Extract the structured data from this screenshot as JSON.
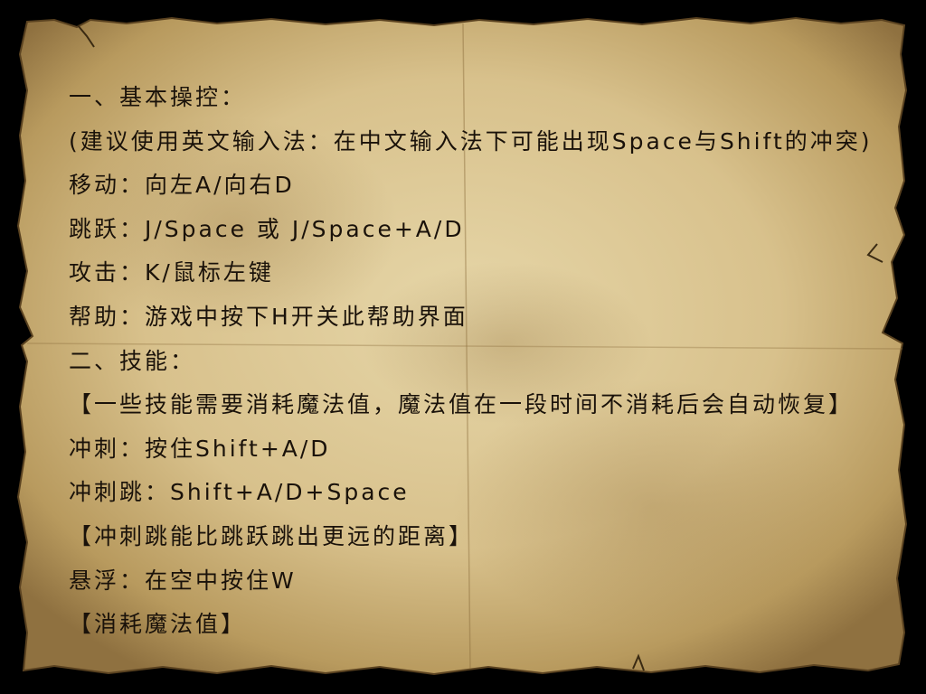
{
  "screen": {
    "background_color": "#000000",
    "parchment_color": "#d9c593",
    "text_color": "#1a120a"
  },
  "help_lines": [
    "一、基本操控：",
    "(建议使用英文输入法：在中文输入法下可能出现Space与Shift的冲突)",
    "移动：向左A/向右D",
    "跳跃：J/Space 或 J/Space+A/D",
    "攻击：K/鼠标左键",
    "帮助：游戏中按下H开关此帮助界面",
    "二、技能：",
    "【一些技能需要消耗魔法值，魔法值在一段时间不消耗后会自动恢复】",
    "冲刺：按住Shift+A/D",
    "冲刺跳：Shift+A/D+Space",
    "【冲刺跳能比跳跃跳出更远的距离】",
    "悬浮：在空中按住W",
    "【消耗魔法值】"
  ]
}
